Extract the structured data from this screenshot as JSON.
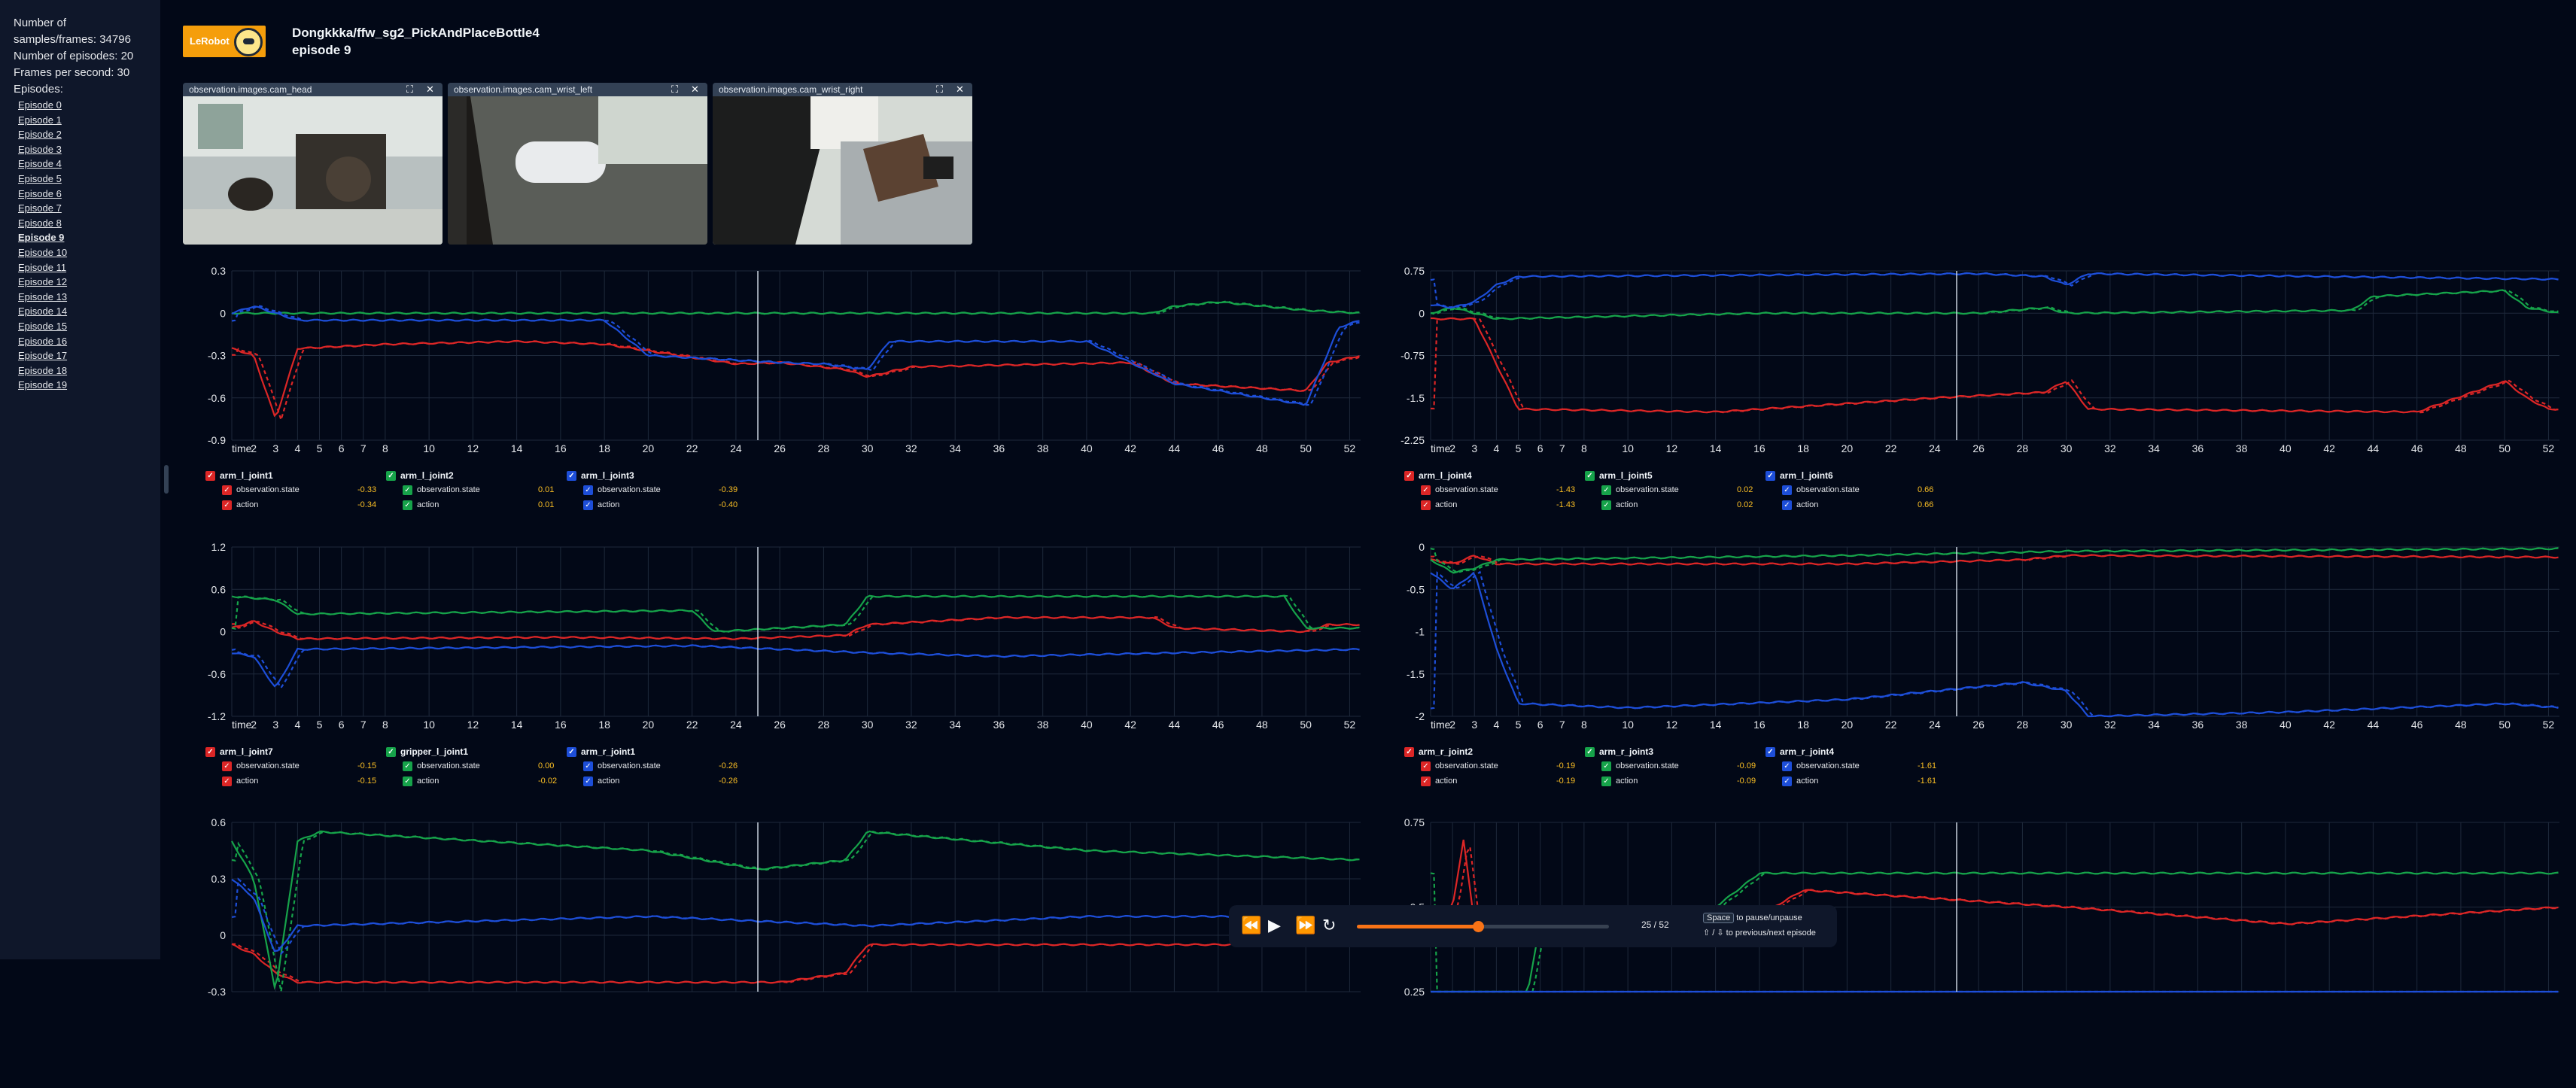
{
  "sidebar": {
    "stats": {
      "samples": "Number of samples/frames: 34796",
      "episodes": "Number of episodes: 20",
      "fps": "Frames per second: 30"
    },
    "episodes_label": "Episodes:",
    "episodes": [
      "Episode 0",
      "Episode 1",
      "Episode 2",
      "Episode 3",
      "Episode 4",
      "Episode 5",
      "Episode 6",
      "Episode 7",
      "Episode 8",
      "Episode 9",
      "Episode 10",
      "Episode 11",
      "Episode 12",
      "Episode 13",
      "Episode 14",
      "Episode 15",
      "Episode 16",
      "Episode 17",
      "Episode 18",
      "Episode 19"
    ],
    "active_index": 9
  },
  "header": {
    "logo_text": "LeRobot",
    "dataset": "Dongkkka/ffw_sg2_PickAndPlaceBottle4",
    "episode": "episode 9"
  },
  "cameras": [
    {
      "name": "observation.images.cam_head"
    },
    {
      "name": "observation.images.cam_wrist_left"
    },
    {
      "name": "observation.images.cam_wrist_right"
    }
  ],
  "colors": {
    "red": "#dc2626",
    "green": "#16a34a",
    "blue": "#1d4ed8"
  },
  "xaxis": {
    "label": "time",
    "ticks": [
      1,
      2,
      3,
      4,
      5,
      6,
      7,
      8,
      10,
      12,
      14,
      16,
      18,
      20,
      22,
      24,
      26,
      28,
      30,
      32,
      34,
      36,
      38,
      40,
      42,
      44,
      46,
      48,
      50,
      52
    ]
  },
  "current_time": 25,
  "plots": [
    {
      "yticks": [
        "0.3",
        "0",
        "-0.3",
        "-0.6",
        "-0.9"
      ],
      "ylim": [
        -0.9,
        0.3
      ],
      "groups": [
        {
          "name": "arm_l_joint1",
          "color": "red",
          "state": "-0.33",
          "action": "-0.34"
        },
        {
          "name": "arm_l_joint2",
          "color": "green",
          "state": "0.01",
          "action": "0.01"
        },
        {
          "name": "arm_l_joint3",
          "color": "blue",
          "state": "-0.39",
          "action": "-0.40"
        }
      ]
    },
    {
      "yticks": [
        "0.75",
        "0",
        "-0.75",
        "-1.5",
        "-2.25"
      ],
      "ylim": [
        -2.25,
        0.75
      ],
      "groups": [
        {
          "name": "arm_l_joint4",
          "color": "red",
          "state": "-1.43",
          "action": "-1.43"
        },
        {
          "name": "arm_l_joint5",
          "color": "green",
          "state": "0.02",
          "action": "0.02"
        },
        {
          "name": "arm_l_joint6",
          "color": "blue",
          "state": "0.66",
          "action": "0.66"
        }
      ]
    },
    {
      "yticks": [
        "1.2",
        "0.6",
        "0",
        "-0.6",
        "-1.2"
      ],
      "ylim": [
        -1.2,
        1.2
      ],
      "groups": [
        {
          "name": "arm_l_joint7",
          "color": "red",
          "state": "-0.15",
          "action": "-0.15"
        },
        {
          "name": "gripper_l_joint1",
          "color": "green",
          "state": "0.00",
          "action": "-0.02"
        },
        {
          "name": "arm_r_joint1",
          "color": "blue",
          "state": "-0.26",
          "action": "-0.26"
        }
      ]
    },
    {
      "yticks": [
        "0",
        "-0.5",
        "-1",
        "-1.5",
        "-2"
      ],
      "ylim": [
        -2,
        0
      ],
      "groups": [
        {
          "name": "arm_r_joint2",
          "color": "red",
          "state": "-0.19",
          "action": "-0.19"
        },
        {
          "name": "arm_r_joint3",
          "color": "green",
          "state": "-0.09",
          "action": "-0.09"
        },
        {
          "name": "arm_r_joint4",
          "color": "blue",
          "state": "-1.61",
          "action": "-1.61"
        }
      ]
    },
    {
      "yticks": [
        "0.6",
        "0.3",
        "0",
        "-0.3"
      ],
      "ylim": [
        -0.3,
        0.6
      ],
      "groups": []
    },
    {
      "yticks": [
        "0.75",
        "0.5",
        "0.25"
      ],
      "ylim": [
        0.25,
        0.75
      ],
      "groups": []
    }
  ],
  "legend_labels": {
    "state": "observation.state",
    "action": "action"
  },
  "player": {
    "frame": "25 / 52",
    "progress": 0.48,
    "hint_space_key": "Space",
    "hint_space": "to pause/unpause",
    "hint_arrows_key": "⇧ / ⇩",
    "hint_arrows": "to previous/next episode"
  }
}
